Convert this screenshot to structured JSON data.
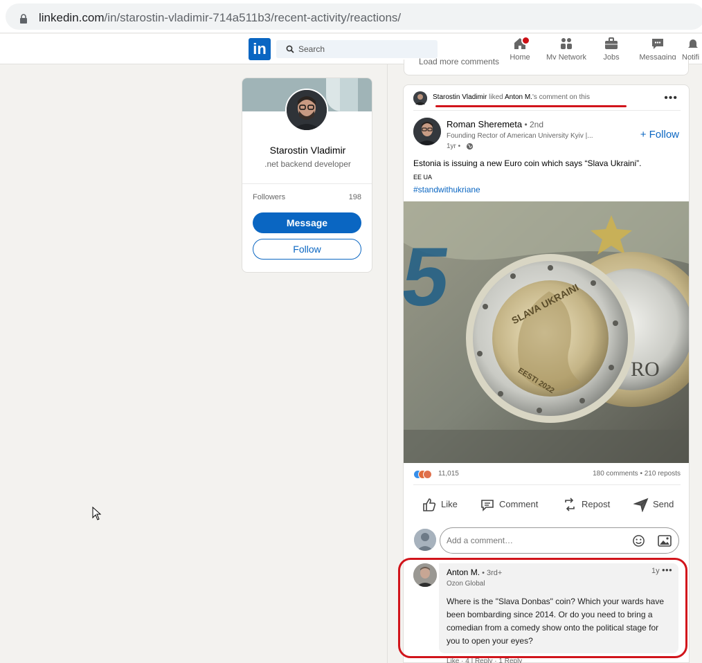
{
  "browser": {
    "url_host": "linkedin.com",
    "url_path": "/in/starostin-vladimir-714a511b3/recent-activity/reactions/"
  },
  "nav": {
    "logo_text": "in",
    "search_placeholder": "Search",
    "items": [
      {
        "label": "Home",
        "icon": "home-icon"
      },
      {
        "label": "My Network",
        "icon": "network-icon"
      },
      {
        "label": "Jobs",
        "icon": "briefcase-icon"
      },
      {
        "label": "Messaging",
        "icon": "messaging-icon"
      },
      {
        "label": "Notifi",
        "icon": "bell-icon"
      }
    ],
    "brand_color": "#0a66c2"
  },
  "profile": {
    "name": "Starostin Vladimir",
    "headline": ".net backend developer",
    "followers_label": "Followers",
    "followers_count": "198",
    "message_button": "Message",
    "follow_button": "Follow"
  },
  "previous_card": {
    "load_more": "Load more comments"
  },
  "post": {
    "activity": {
      "actor": "Starostin Vladimir",
      "verb": " liked ",
      "target": "Anton M.",
      "suffix": "'s comment on this"
    },
    "author": {
      "name": "Roman Sheremeta",
      "degree": " • 2nd",
      "subtitle": "Founding Rector of American University Kyiv |...",
      "time": "1yr •"
    },
    "follow_label": "+ Follow",
    "text": "Estonia is issuing a new Euro coin which says “Slava Ukraini”.",
    "flags": "EE UA",
    "hashtag": "#standwithukriane",
    "image": {
      "coin_text": "SLAVA UKRAINI",
      "coin_bottom": "EESTI 2022",
      "note_digit": "5",
      "back_coin": "RO"
    },
    "reactions_count": "11,015",
    "stats": "180 comments • 210 reposts",
    "actions": [
      {
        "label": "Like",
        "icon": "like-icon"
      },
      {
        "label": "Comment",
        "icon": "comment-icon"
      },
      {
        "label": "Repost",
        "icon": "repost-icon"
      },
      {
        "label": "Send",
        "icon": "send-icon"
      }
    ],
    "comment_placeholder": "Add a comment…"
  },
  "comment": {
    "name": "Anton M.",
    "degree": " • 3rd+",
    "subtitle": "Ozon Global",
    "time": "1y",
    "text": "Where is the \"Slava Donbas\" coin? Which your wards have been bombarding since 2014. Or do you need to bring a comedian from a comedy show onto the political stage for you to open your eyes?",
    "actions": "Like · 4 | Reply · 1 Reply"
  },
  "colors": {
    "highlight_red": "#d1141b",
    "link_blue": "#0a66c2",
    "page_bg": "#f3f2ef"
  }
}
